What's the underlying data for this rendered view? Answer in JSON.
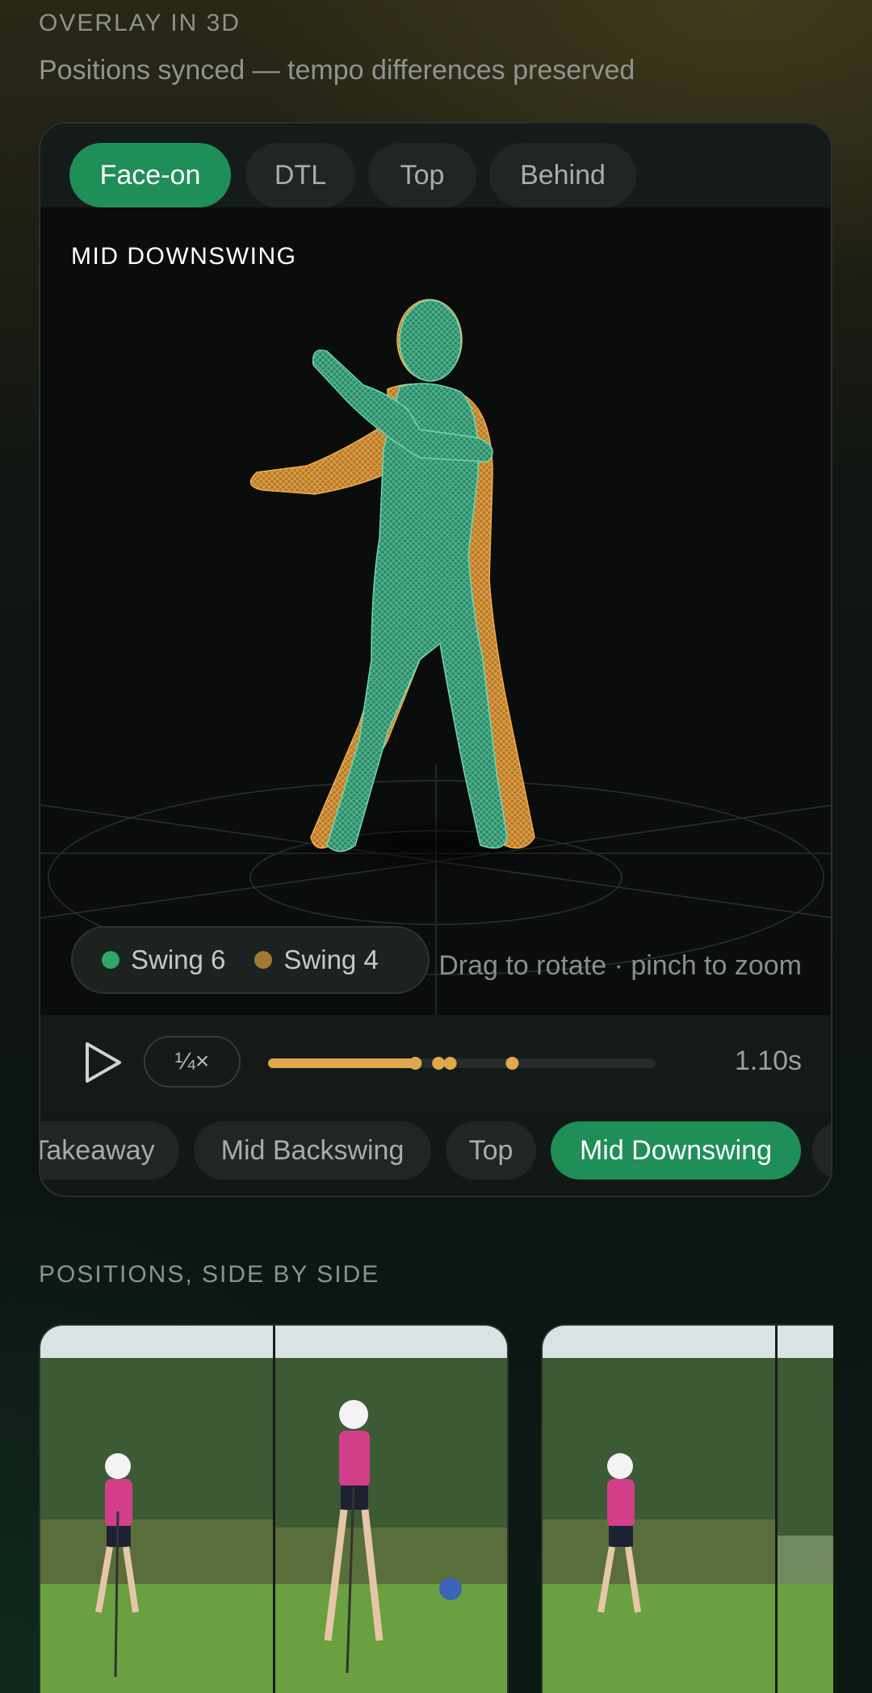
{
  "header": {
    "kicker": "OVERLAY IN 3D",
    "subtitle": "Positions synced — tempo differences preserved"
  },
  "view_tabs": [
    {
      "label": "Face-on",
      "active": true
    },
    {
      "label": "DTL",
      "active": false
    },
    {
      "label": "Top",
      "active": false
    },
    {
      "label": "Behind",
      "active": false
    }
  ],
  "viewport": {
    "phase_label": "MID DOWNSWING",
    "hint": "Drag to rotate · pinch to zoom",
    "legend": [
      {
        "label": "Swing 6",
        "color": "#2fa866"
      },
      {
        "label": "Swing 4",
        "color": "#a07a35"
      }
    ]
  },
  "controls": {
    "speed": "¼×",
    "time": "1.10s",
    "progress": 0.38,
    "markers": [
      0.38,
      0.44,
      0.47,
      0.63
    ],
    "track_color": "#e0a84a"
  },
  "phases": [
    {
      "label": "Takeaway",
      "active": false
    },
    {
      "label": "Mid Backswing",
      "active": false
    },
    {
      "label": "Top",
      "active": false
    },
    {
      "label": "Mid Downswing",
      "active": true
    }
  ],
  "positions": {
    "title": "POSITIONS, SIDE BY SIDE"
  },
  "colors": {
    "accent": "#1f8f57",
    "mesh_primary": "#3fbf8c",
    "mesh_secondary": "#e6a23c"
  },
  "icons": {
    "play": "play-icon"
  }
}
